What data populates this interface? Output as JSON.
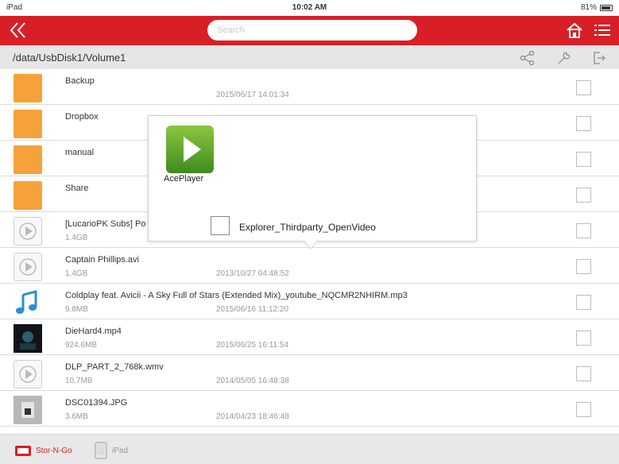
{
  "status_bar": {
    "device": "iPad",
    "time": "10:02 AM",
    "battery": "81%"
  },
  "top_bar": {
    "search_placeholder": "Search"
  },
  "path_bar": {
    "path": "/data/UsbDisk1/Volume1"
  },
  "files": [
    {
      "name": "Backup",
      "size": "",
      "date": "2015/06/17 14:01:34",
      "type": "folder"
    },
    {
      "name": "Dropbox",
      "size": "",
      "date": "",
      "type": "folder"
    },
    {
      "name": "manual",
      "size": "",
      "date": "",
      "type": "folder"
    },
    {
      "name": "Share",
      "size": "",
      "date": "",
      "type": "folder"
    },
    {
      "name": "[LucarioPK Subs] Po",
      "size": "1.4GB",
      "date": "",
      "type": "video"
    },
    {
      "name": "Captain Phillips.avi",
      "size": "1.4GB",
      "date": "2013/10/27 04:48:52",
      "type": "video"
    },
    {
      "name": "Coldplay feat. Avicii - A Sky Full of Stars (Extended Mix)_youtube_NQCMR2NHIRM.mp3",
      "size": "9.8MB",
      "date": "2015/06/16 11:12:20",
      "type": "audio"
    },
    {
      "name": "DieHard4.mp4",
      "size": "924.6MB",
      "date": "2015/06/25 16:11:54",
      "type": "movie"
    },
    {
      "name": "DLP_PART_2_768k.wmv",
      "size": "10.7MB",
      "date": "2014/05/05 16:48:38",
      "type": "video"
    },
    {
      "name": "DSC01394.JPG",
      "size": "3.6MB",
      "date": "2014/04/23 18:46:48",
      "type": "photo"
    }
  ],
  "popup": {
    "app_name": "AcePlayer",
    "option_label": "Explorer_Thirdparty_OpenVideo"
  },
  "bottom_bar": {
    "stor_n_go_label": "Stor-N-Go",
    "ipad_label": "iPad"
  },
  "colors": {
    "accent": "#d81f26",
    "folder": "#f6a23a"
  }
}
